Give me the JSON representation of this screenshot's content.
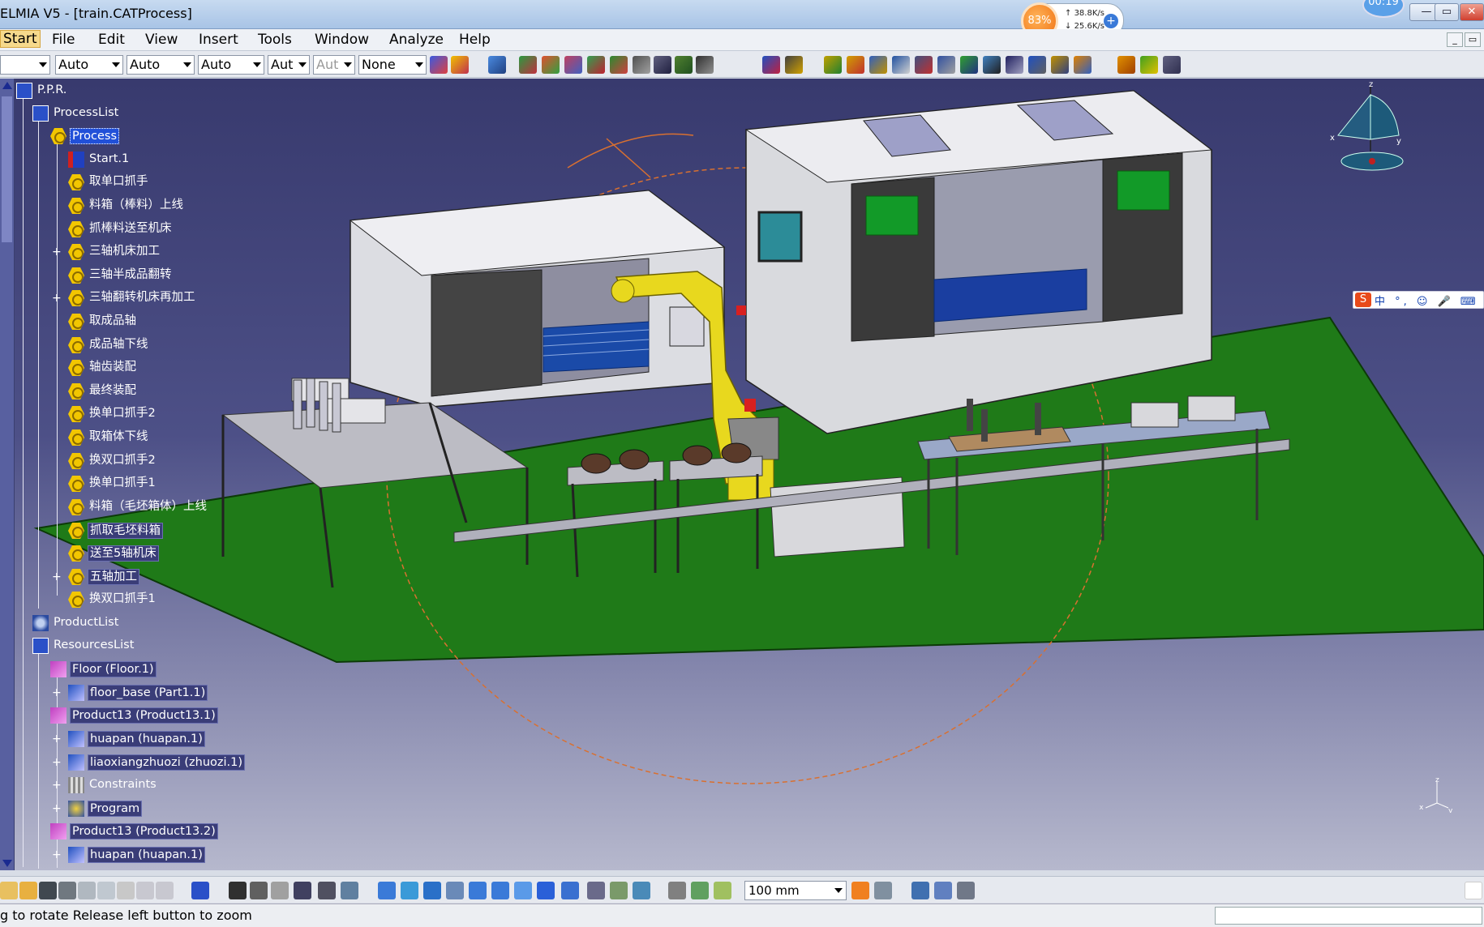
{
  "window": {
    "title": "ELMIA V5 - [train.CATProcess]",
    "clock": "00:19",
    "controls": {
      "minimize": "—",
      "restore": "▭",
      "close": "✕"
    }
  },
  "net_monitor": {
    "cpu": "83%",
    "upload": "38.8K/s",
    "download": "25.6K/s"
  },
  "menu": [
    "Start",
    "File",
    "Edit",
    "View",
    "Insert",
    "Tools",
    "Window",
    "Analyze",
    "Help"
  ],
  "toolbar": {
    "combos": [
      {
        "value": ""
      },
      {
        "value": "Auto"
      },
      {
        "value": "Auto"
      },
      {
        "value": "Auto"
      },
      {
        "value": "Aut"
      },
      {
        "value": "Aut",
        "disabled": true
      },
      {
        "value": "None"
      }
    ]
  },
  "tree": {
    "root": "P.P.R.",
    "process_list": "ProcessList",
    "process": "Process",
    "activities": [
      "Start.1",
      "取单口抓手",
      "料箱（棒料）上线",
      "抓棒料送至机床",
      "三轴机床加工",
      "三轴半成品翻转",
      "三轴翻转机床再加工",
      "取成品轴",
      "成品轴下线",
      "轴齿装配",
      "最终装配",
      "换单口抓手2",
      "取箱体下线",
      "换双口抓手2",
      "换单口抓手1",
      "料箱（毛坯箱体）上线",
      "抓取毛坯料箱",
      "送至5轴机床",
      "五轴加工",
      "换双口抓手1"
    ],
    "product_list": "ProductList",
    "resources_list": "ResourcesList",
    "resources": [
      "Floor (Floor.1)",
      "floor_base (Part1.1)",
      "Product13 (Product13.1)",
      "huapan (huapan.1)",
      "liaoxiangzhuozi (zhuozi.1)",
      "Constraints",
      "Program",
      "Product13 (Product13.2)",
      "huapan (huapan.1)"
    ]
  },
  "compass": {
    "x": "x",
    "y": "y",
    "z": "z"
  },
  "mini_axis": {
    "x": "x",
    "y": "y",
    "z": "z"
  },
  "ime": {
    "text": "中 °, ☺ 🎤 ⌨"
  },
  "bottom_toolbar": {
    "zoom": "100 mm"
  },
  "status": {
    "message": "g to rotate  Release left button to zoom"
  },
  "colors": {
    "viewport_top": "#383a6e",
    "floor": "#1f7a18",
    "robot": "#e8d81e",
    "machine": "#d9dade",
    "accent": "#f07010"
  }
}
